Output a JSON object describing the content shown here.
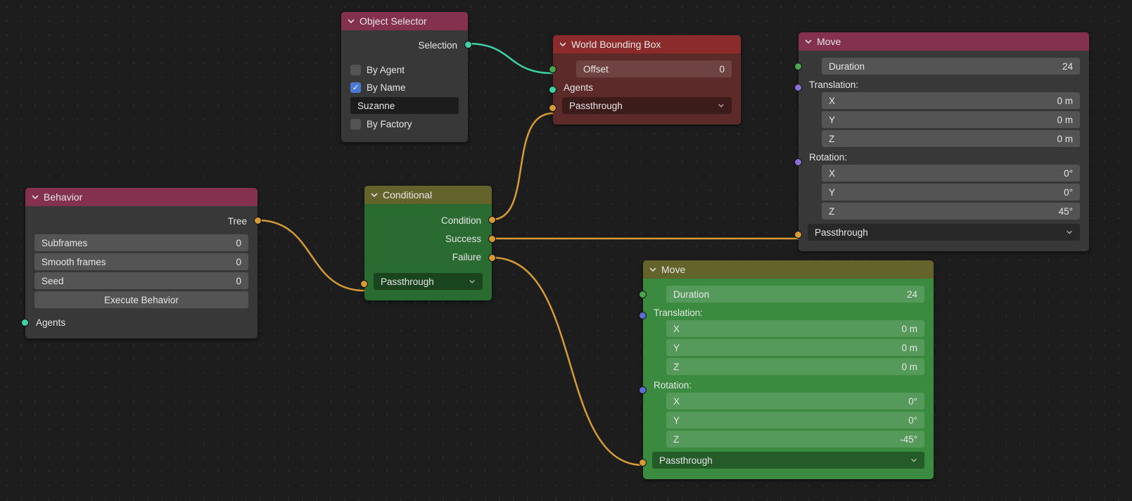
{
  "nodes": {
    "behavior": {
      "title": "Behavior",
      "tree_label": "Tree",
      "subframes_label": "Subframes",
      "subframes_value": "0",
      "smooth_label": "Smooth frames",
      "smooth_value": "0",
      "seed_label": "Seed",
      "seed_value": "0",
      "execute_label": "Execute Behavior",
      "agents_label": "Agents"
    },
    "object_selector": {
      "title": "Object Selector",
      "selection_label": "Selection",
      "by_agent": "By Agent",
      "by_name": "By Name",
      "name_value": "Suzanne",
      "by_factory": "By Factory"
    },
    "conditional": {
      "title": "Conditional",
      "condition": "Condition",
      "success": "Success",
      "failure": "Failure",
      "passthrough": "Passthrough"
    },
    "wbb": {
      "title": "World Bounding Box",
      "offset_label": "Offset",
      "offset_value": "0",
      "agents_label": "Agents",
      "passthrough": "Passthrough"
    },
    "move1": {
      "title": "Move",
      "duration_label": "Duration",
      "duration_value": "24",
      "translation_label": "Translation:",
      "tx_label": "X",
      "tx_value": "0 m",
      "ty_label": "Y",
      "ty_value": "0 m",
      "tz_label": "Z",
      "tz_value": "0 m",
      "rotation_label": "Rotation:",
      "rx_label": "X",
      "rx_value": "0°",
      "ry_label": "Y",
      "ry_value": "0°",
      "rz_label": "Z",
      "rz_value": "45°",
      "passthrough": "Passthrough"
    },
    "move2": {
      "title": "Move",
      "duration_label": "Duration",
      "duration_value": "24",
      "translation_label": "Translation:",
      "tx_label": "X",
      "tx_value": "0 m",
      "ty_label": "Y",
      "ty_value": "0 m",
      "tz_label": "Z",
      "tz_value": "0 m",
      "rotation_label": "Rotation:",
      "rx_label": "X",
      "rx_value": "0°",
      "ry_label": "Y",
      "ry_value": "0°",
      "rz_label": "Z",
      "rz_value": "-45°",
      "passthrough": "Passthrough"
    }
  },
  "colors": {
    "link_teal": "#3fd0a8",
    "link_orange": "#d69b34"
  }
}
